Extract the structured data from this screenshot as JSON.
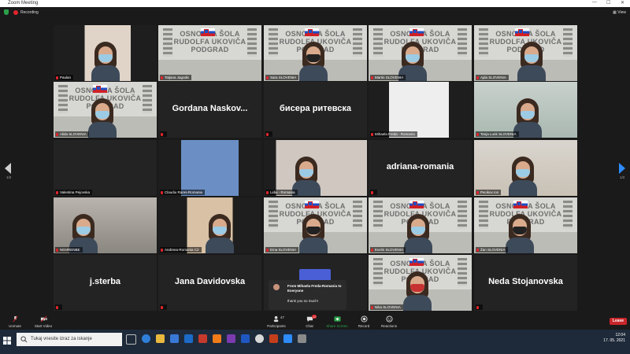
{
  "window": {
    "title": "Zoom Meeting",
    "recording_label": "Recording",
    "view_label": "View"
  },
  "nav": {
    "page_left": "1/2",
    "page_right": "1/2"
  },
  "participants": [
    {
      "name": "Paulan",
      "display": ""
    },
    {
      "name": "Tatjana Jagodic",
      "display": ""
    },
    {
      "name": "Sara SLOVENIA",
      "display": ""
    },
    {
      "name": "Martin SLOVENIA",
      "display": ""
    },
    {
      "name": "Ajda SLOVENIA",
      "display": ""
    },
    {
      "name": "Alida SLOVENIA",
      "display": ""
    },
    {
      "name": "",
      "display": "Gordana  Naskov..."
    },
    {
      "name": "",
      "display": "бисера ритевска"
    },
    {
      "name": "Mihaela Freda - Romania",
      "display": ""
    },
    {
      "name": "Tanja Lunk SLOVENIA",
      "display": ""
    },
    {
      "name": "Valentina Pejovska",
      "display": ""
    },
    {
      "name": "Claudiu Rares-Romania",
      "display": ""
    },
    {
      "name": "Lidia - Romania",
      "display": ""
    },
    {
      "name": "",
      "display": "adriana-romania"
    },
    {
      "name": "Pecikov Ion",
      "display": ""
    },
    {
      "name": "NEMRENBE",
      "display": ""
    },
    {
      "name": "Andreea-Romania C2",
      "display": ""
    },
    {
      "name": "Ema SLOVENIA",
      "display": ""
    },
    {
      "name": "Evelin SLOVENIA",
      "display": ""
    },
    {
      "name": "Žan SLOVENIA",
      "display": ""
    },
    {
      "name": "",
      "display": "j.sterba"
    },
    {
      "name": "",
      "display": "Jana Davidovska"
    },
    {
      "name": "",
      "display": ""
    },
    {
      "name": "Nika SLOVENIA",
      "display": ""
    },
    {
      "name": "",
      "display": "Neda Stojanovska"
    }
  ],
  "school_sign": "OSNOVNA ŠOLA\nRUDOLFA UKOVIČA\nPODGRAD",
  "chat_popup": {
    "from": "From Mihaela Freda-Romania to Everyone",
    "message": "thank you so much!"
  },
  "toolbar": {
    "unmute": "Unmute",
    "start_video": "Start Video",
    "participants": "Participants",
    "participants_count": "47",
    "chat": "Chat",
    "chat_badge": "12",
    "share_screen": "Share Screen",
    "record": "Record",
    "reactions": "Reactions",
    "leave": "Leave"
  },
  "taskbar": {
    "search_placeholder": "Tukaj vnesite izraz za iskanje",
    "time": "12:04",
    "date": "17. 05. 2021"
  },
  "colors": {
    "slovenia_flag": [
      "#ffffff",
      "#1e4fc6",
      "#d21f24"
    ],
    "leave": "#c9262b",
    "share": "#2ca14a",
    "record": "#e0242b"
  }
}
